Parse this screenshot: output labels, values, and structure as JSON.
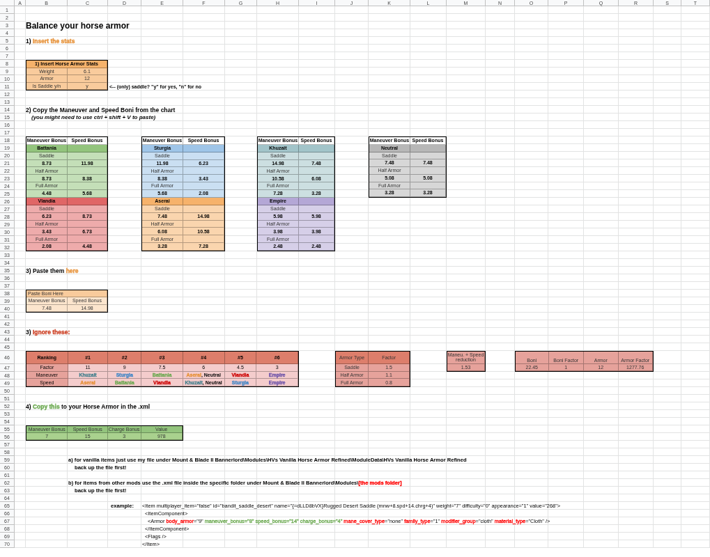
{
  "columns": [
    "A",
    "B",
    "C",
    "D",
    "E",
    "F",
    "G",
    "H",
    "I",
    "J",
    "K",
    "L",
    "M",
    "N",
    "O",
    "P",
    "Q",
    "R",
    "S",
    "T"
  ],
  "rows": [
    "1",
    "2",
    "3",
    "4",
    "5",
    "6",
    "7",
    "8",
    "9",
    "10",
    "11",
    "12",
    "13",
    "14",
    "15",
    "16",
    "17",
    "18",
    "19",
    "20",
    "21",
    "22",
    "23",
    "24",
    "25",
    "26",
    "27",
    "28",
    "29",
    "30",
    "31",
    "32",
    "33",
    "34",
    "35",
    "36",
    "37",
    "38",
    "39",
    "40",
    "41",
    "42",
    "43",
    "44",
    "45",
    "46",
    "47",
    "48",
    "49",
    "50",
    "51",
    "52",
    "53",
    "54",
    "55",
    "56",
    "57",
    "58",
    "59",
    "60",
    "61",
    "62",
    "63",
    "64",
    "65",
    "66",
    "67",
    "68",
    "69",
    "70"
  ],
  "title": "Balance your horse armor",
  "headings": [
    {
      "parts": [
        {
          "text": "1) "
        },
        {
          "text": "Insert the stats",
          "color": "#e69138"
        }
      ]
    },
    {
      "parts": [
        {
          "text": "2) Copy the Maneuver and Speed Boni from the chart"
        }
      ]
    },
    {
      "parts": [
        {
          "text": "3) Paste them "
        },
        {
          "text": "here",
          "color": "#e69138"
        }
      ]
    },
    {
      "parts": [
        {
          "text": "3) "
        },
        {
          "text": "Ignore these:",
          "color": "#cc4125"
        }
      ]
    },
    {
      "parts": [
        {
          "text": "4) "
        },
        {
          "text": "Copy this",
          "color": "#6aa84f"
        },
        {
          "text": " to your Horse Armor in the .xml"
        }
      ]
    }
  ],
  "hint": "(you might need to use ctrl + shift + V to paste)",
  "stats_table": {
    "title": "1) Insert Horse Armor Stats",
    "rows": [
      {
        "label": "Weight",
        "value": "6.1"
      },
      {
        "label": "Armor",
        "value": "12"
      },
      {
        "label": "Is Saddle y/n",
        "value": "y"
      }
    ],
    "note": "<-- (only) saddle? \"y\" for yes, \"n\" for no"
  },
  "faction_charts": [
    {
      "columns": [
        "Maneuver Bonus",
        "Speed Bonus"
      ],
      "factions": [
        {
          "name": "Battania",
          "color": "#93c47d",
          "armors": [
            {
              "type": "Saddle",
              "maneuver": "8.73",
              "speed": "11.98"
            },
            {
              "type": "Half Armor",
              "maneuver": "8.73",
              "speed": "8.38"
            },
            {
              "type": "Full Armor",
              "maneuver": "4.48",
              "speed": "5.68"
            }
          ]
        },
        {
          "name": "Vlandia",
          "color": "#e06666",
          "armors": [
            {
              "type": "Saddle",
              "maneuver": "6.23",
              "speed": "8.73"
            },
            {
              "type": "Half Armor",
              "maneuver": "3.43",
              "speed": "6.73"
            },
            {
              "type": "Full Armor",
              "maneuver": "2.08",
              "speed": "4.48"
            }
          ]
        }
      ]
    },
    {
      "columns": [
        "Maneuver Bonus",
        "Speed Bonus"
      ],
      "factions": [
        {
          "name": "Sturgia",
          "color": "#9fc5e8",
          "armors": [
            {
              "type": "Saddle",
              "maneuver": "11.98",
              "speed": "6.23"
            },
            {
              "type": "Half Armor",
              "maneuver": "8.38",
              "speed": "3.43"
            },
            {
              "type": "Full Armor",
              "maneuver": "5.68",
              "speed": "2.08"
            }
          ]
        },
        {
          "name": "Aserai",
          "color": "#f6b26b",
          "armors": [
            {
              "type": "Saddle",
              "maneuver": "7.48",
              "speed": "14.98"
            },
            {
              "type": "Half Armor",
              "maneuver": "6.08",
              "speed": "10.58"
            },
            {
              "type": "Full Armor",
              "maneuver": "3.28",
              "speed": "7.28"
            }
          ]
        }
      ]
    },
    {
      "columns": [
        "Maneuver Bonus",
        "Speed Bonus"
      ],
      "factions": [
        {
          "name": "Khuzait",
          "color": "#a2c4c9",
          "armors": [
            {
              "type": "Saddle",
              "maneuver": "14.98",
              "speed": "7.48"
            },
            {
              "type": "Half Armor",
              "maneuver": "10.58",
              "speed": "6.08"
            },
            {
              "type": "Full Armor",
              "maneuver": "7.28",
              "speed": "3.28"
            }
          ]
        },
        {
          "name": "Empire",
          "color": "#b4a7d6",
          "armors": [
            {
              "type": "Saddle",
              "maneuver": "5.98",
              "speed": "5.98"
            },
            {
              "type": "Half Armor",
              "maneuver": "3.98",
              "speed": "3.98"
            },
            {
              "type": "Full Armor",
              "maneuver": "2.48",
              "speed": "2.48"
            }
          ]
        }
      ]
    },
    {
      "columns": [
        "Maneuver Bonus",
        "Speed Bonus"
      ],
      "factions": [
        {
          "name": "Neutral",
          "color": "#b7b7b7",
          "armors": [
            {
              "type": "Saddle",
              "maneuver": "7.48",
              "speed": "7.48"
            },
            {
              "type": "Half Armor",
              "maneuver": "5.08",
              "speed": "5.08"
            },
            {
              "type": "Full Armor",
              "maneuver": "3.28",
              "speed": "3.28"
            }
          ]
        }
      ]
    }
  ],
  "paste_table": {
    "title": "Paste Boni Here",
    "columns": [
      "Maneuver Bonus",
      "Speed Bonus"
    ],
    "values": [
      "7.48",
      "14.98"
    ]
  },
  "ranking_table": {
    "columns": [
      "Ranking",
      "#1",
      "#2",
      "#3",
      "#4",
      "#5",
      "#6"
    ],
    "rows": [
      {
        "cells": [
          [
            {
              "text": "Factor"
            }
          ],
          [
            {
              "text": "11"
            }
          ],
          [
            {
              "text": "9"
            }
          ],
          [
            {
              "text": "7.5"
            }
          ],
          [
            {
              "text": "6"
            }
          ],
          [
            {
              "text": "4.5"
            }
          ],
          [
            {
              "text": "3"
            }
          ]
        ]
      },
      {
        "cells": [
          [
            {
              "text": "Maneuver"
            }
          ],
          [
            {
              "text": "Khuzait",
              "color": "#45818e"
            }
          ],
          [
            {
              "text": "Sturgia",
              "color": "#3d85c6"
            }
          ],
          [
            {
              "text": "Battania",
              "color": "#6aa84f"
            }
          ],
          [
            {
              "text": "Aserai",
              "color": "#e69138"
            },
            {
              "text": ", Neutral"
            }
          ],
          [
            {
              "text": "Vlandia",
              "color": "#cc0000"
            }
          ],
          [
            {
              "text": "Empire",
              "color": "#674ea7"
            }
          ]
        ]
      },
      {
        "cells": [
          [
            {
              "text": "Speed"
            }
          ],
          [
            {
              "text": "Aserai",
              "color": "#e69138"
            }
          ],
          [
            {
              "text": "Battania",
              "color": "#6aa84f"
            }
          ],
          [
            {
              "text": "Vlandia",
              "color": "#cc0000"
            }
          ],
          [
            {
              "text": "Khuzait",
              "color": "#45818e"
            },
            {
              "text": ", Neutral"
            }
          ],
          [
            {
              "text": "Sturgia",
              "color": "#3d85c6"
            }
          ],
          [
            {
              "text": "Empire",
              "color": "#674ea7"
            }
          ]
        ]
      }
    ]
  },
  "armor_factor_table": {
    "columns": [
      "Armor Type",
      "Factor"
    ],
    "rows": [
      {
        "type": "Saddle",
        "factor": "1.5"
      },
      {
        "type": "Half Armor",
        "factor": "1.1"
      },
      {
        "type": "Full Armor",
        "factor": "0.8"
      }
    ]
  },
  "reduction": {
    "label": "Maneu. + Speed reduction",
    "value": "1.53"
  },
  "boni_table": {
    "columns": [
      "Boni",
      "Boni Factor",
      "Armor",
      "Armor Factor"
    ],
    "values": [
      "22.45",
      "1",
      "12",
      "1277.76"
    ]
  },
  "output_table": {
    "columns": [
      "Maneuver Bonus",
      "Speed Bonus",
      "Charge Bonus",
      "Value"
    ],
    "values": [
      "7",
      "15",
      "3",
      "978"
    ]
  },
  "instructions": [
    {
      "kind": "step",
      "parts": [
        {
          "text": "a) for vanilla items just use my file under Mount & Blade II Bannerlord\\Modules\\HVs Vanilla Horse Armor Refined\\ModuleData\\HVs Vanilla Horse Armor Refined"
        }
      ]
    },
    {
      "kind": "note",
      "parts": [
        {
          "text": "back up the file first!"
        }
      ]
    },
    {
      "kind": "step",
      "parts": [
        {
          "text": "b) for items from other mods use the .xml file inside the specific folder under Mount & Blade II Bannerlord\\Modules\\"
        },
        {
          "text": "[the mods folder]",
          "color": "#ff0000"
        }
      ]
    },
    {
      "kind": "note",
      "parts": [
        {
          "text": "back up the file first!"
        }
      ]
    }
  ],
  "example": {
    "label": "example:",
    "lines": [
      {
        "parts": [
          {
            "text": "<Item multiplayer_item=\"false\" id=\"bandit_saddle_desert\" name=\"{=dLLD8bVX}Rugged Desert Saddle (mnw+8.spd+14.chrg+4)\" weight=\"7\" difficulty=\"0\" appearance=\"1\" value=\"268\">"
          }
        ]
      },
      {
        "parts": [
          {
            "text": "<ItemComponent>"
          }
        ]
      },
      {
        "parts": [
          {
            "text": "<Armor "
          },
          {
            "text": "body_armor",
            "color": "#ff0000"
          },
          {
            "text": "=\"9\" "
          },
          {
            "text": "maneuver_bonus=\"8\" speed_bonus=\"14\" charge_bonus=\"4\" ",
            "color": "#6aa84f"
          },
          {
            "text": "mane_cover_type",
            "color": "#ff0000"
          },
          {
            "text": "=\"none\" "
          },
          {
            "text": "family_type",
            "color": "#ff0000"
          },
          {
            "text": "=\"1\" "
          },
          {
            "text": "modifier_group",
            "color": "#ff0000"
          },
          {
            "text": "=\"cloth\" "
          },
          {
            "text": "material_type",
            "color": "#ff0000"
          },
          {
            "text": "=\"Cloth\" />"
          }
        ]
      },
      {
        "parts": [
          {
            "text": "</ItemComponent>"
          }
        ]
      },
      {
        "parts": [
          {
            "text": "<Flags />"
          }
        ]
      },
      {
        "parts": [
          {
            "text": "</Item>"
          }
        ]
      }
    ]
  }
}
